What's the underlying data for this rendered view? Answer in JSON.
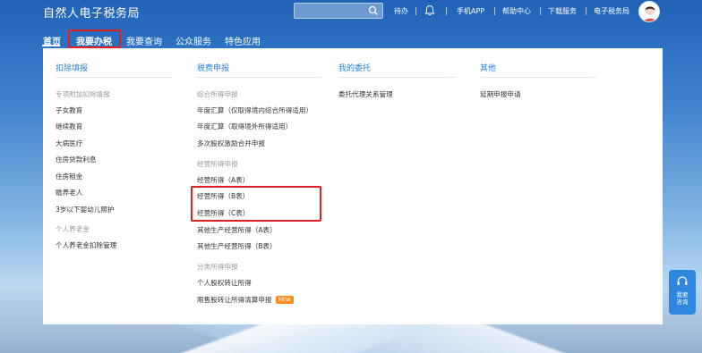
{
  "header": {
    "title": "自然人电子税务局",
    "search": {
      "placeholder": ""
    },
    "links": {
      "todo": "待办",
      "mobile_app": "手机APP",
      "help_center": "帮助中心",
      "download_service": "下载服务",
      "tax_bureau": "电子税务局"
    }
  },
  "nav": {
    "items": [
      {
        "label": "首页"
      },
      {
        "label": "我要办税"
      },
      {
        "label": "我要查询"
      },
      {
        "label": "公众服务"
      },
      {
        "label": "特色应用"
      }
    ],
    "active_index": 0,
    "highlighted_index": 1
  },
  "menu": {
    "columns": [
      {
        "title": "扣除填报",
        "groups": [
          {
            "label": "专项附加扣除填报",
            "items": [
              "子女教育",
              "继续教育",
              "大病医疗",
              "住房贷款利息",
              "住房租金",
              "赡养老人",
              "3岁以下婴幼儿照护"
            ]
          },
          {
            "label": "个人养老金",
            "items": [
              "个人养老金扣除管理"
            ]
          }
        ]
      },
      {
        "title": "税费申报",
        "groups": [
          {
            "label": "综合所得申报",
            "items": [
              "年度汇算（仅取得境内综合所得适用）",
              "年度汇算（取得境外所得适用）",
              "多次股权激励合并申报"
            ]
          },
          {
            "label": "经营所得申报",
            "items": [
              "经营所得（A表）",
              "经营所得（B表）",
              "经营所得（C表）",
              "其他生产经营所得（A表）",
              "其他生产经营所得（B表）"
            ]
          },
          {
            "label": "分类所得申报",
            "items": [
              "个人股权转让所得",
              "限售股转让所得清算申报"
            ]
          }
        ],
        "new_badge": "NEW"
      },
      {
        "title": "我的委托",
        "items": [
          "委托代理关系管理"
        ]
      },
      {
        "title": "其他",
        "items": [
          "延期申报申请"
        ]
      }
    ]
  },
  "help_float": {
    "line1": "我要",
    "line2": "咨询"
  },
  "colors": {
    "accent": "#2f7fd3",
    "highlight": "#e21f1f",
    "badge": "#ff8a1e"
  }
}
